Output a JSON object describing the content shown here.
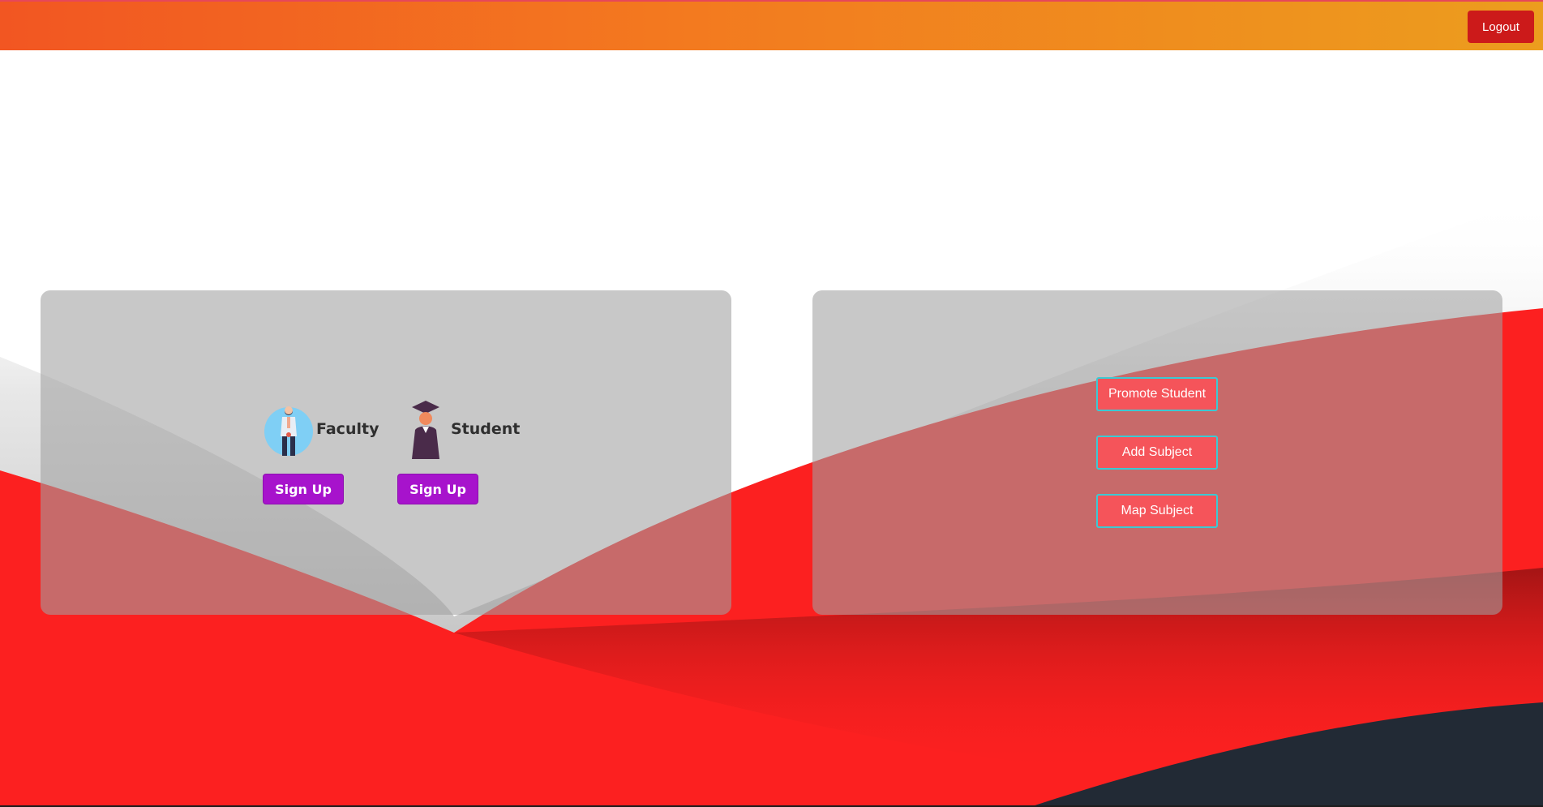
{
  "header": {
    "logout_label": "Logout"
  },
  "signup_panel": {
    "faculty": {
      "label": "Faculty",
      "icon": "faculty-person-icon",
      "button_label": "Sign Up"
    },
    "student": {
      "label": "Student",
      "icon": "graduate-student-icon",
      "button_label": "Sign Up"
    }
  },
  "admin_panel": {
    "buttons": [
      {
        "label": "Promote Student"
      },
      {
        "label": "Add Subject"
      },
      {
        "label": "Map Subject"
      }
    ]
  },
  "colors": {
    "header_gradient_start": "#f25622",
    "header_gradient_end": "#ec9d1e",
    "logout_button": "#cc1a1a",
    "signup_button": "#a713cc",
    "admin_button": "#f5545a",
    "admin_button_border": "#3cc9d3",
    "background_red": "#fc2020",
    "background_dark": "#222a35"
  }
}
